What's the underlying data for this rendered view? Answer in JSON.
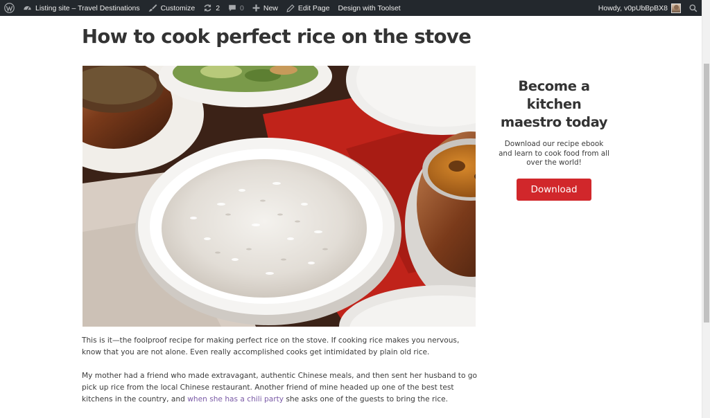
{
  "admin_bar": {
    "site_name": "Listing site – Travel Destinations",
    "customize": "Customize",
    "updates_count": "2",
    "comments_count": "0",
    "new_label": "New",
    "edit_page": "Edit Page",
    "design_toolset": "Design with Toolset",
    "greeting": "Howdy, v0pUbBpBX8"
  },
  "post": {
    "title": "How to cook perfect rice on the stove",
    "hero_image_icon": "rice-bowl-photo",
    "paragraph1": "This is it—the foolproof recipe for making perfect rice on the stove. If cooking rice makes you nervous, know that you are not alone.  Even really accomplished cooks get intimidated by plain old rice.",
    "paragraph2_before": "My mother had a friend who made extravagant, authentic Chinese meals, and then sent her husband to go pick up rice from the local Chinese restaurant.  Another friend of mine headed up one of the best test kitchens in the country, and ",
    "paragraph2_link": "when she has a chili party",
    "paragraph2_after": " she asks one of the guests to bring the rice."
  },
  "sidebar": {
    "cta_title": "Become a kitchen maestro today",
    "cta_text": "Download our recipe ebook and learn to cook food from all over the world!",
    "cta_button": "Download"
  },
  "colors": {
    "admin_bar_bg": "#23282d",
    "cta_button": "#d1272b",
    "link": "#7a5aa6"
  }
}
